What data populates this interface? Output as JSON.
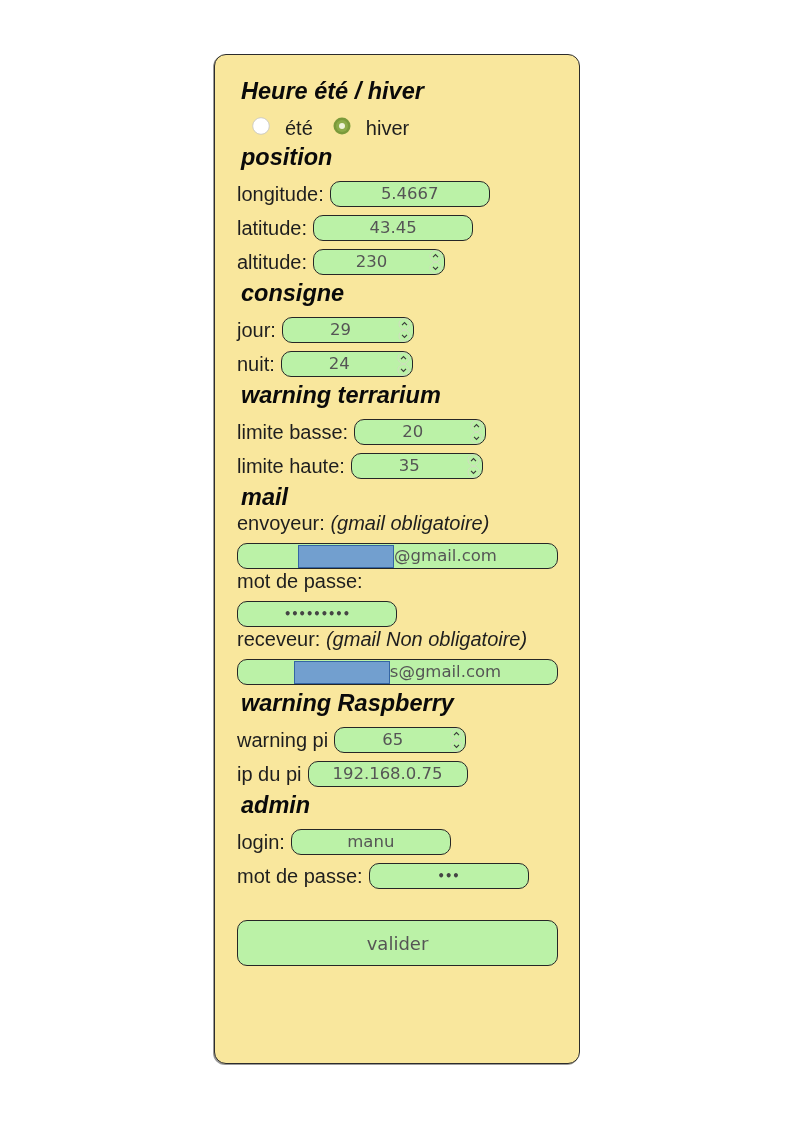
{
  "form": {
    "sections": [
      {
        "title": "Heure été / hiver",
        "items": [
          {
            "kind": "radio_group",
            "options": [
              {
                "label": "été",
                "selected": false
              },
              {
                "label": "hiver",
                "selected": true
              }
            ]
          }
        ]
      },
      {
        "title": "position",
        "items": [
          {
            "kind": "row",
            "label": "longitude:",
            "field": {
              "kind": "text",
              "value": "5.4667"
            }
          },
          {
            "kind": "row",
            "label": "latitude:",
            "field": {
              "kind": "text",
              "value": "43.45"
            }
          },
          {
            "kind": "row",
            "label": "altitude:",
            "field": {
              "kind": "number",
              "value": "230"
            }
          }
        ]
      },
      {
        "title": "consigne",
        "items": [
          {
            "kind": "row",
            "label": "jour:",
            "field": {
              "kind": "number",
              "value": "29"
            }
          },
          {
            "kind": "row",
            "label": "nuit:",
            "field": {
              "kind": "number",
              "value": "24"
            }
          }
        ]
      },
      {
        "title": "warning terrarium",
        "items": [
          {
            "kind": "row",
            "label": "limite basse:",
            "field": {
              "kind": "number",
              "value": "20"
            }
          },
          {
            "kind": "row",
            "label": "limite haute:",
            "field": {
              "kind": "number",
              "value": "35"
            }
          }
        ]
      },
      {
        "title": "mail",
        "items": [
          {
            "kind": "stacked",
            "label": "envoyeur: *(gmail obligatoire)*",
            "field": {
              "kind": "email",
              "value": "@gmail.com",
              "redacted": true
            }
          },
          {
            "kind": "stacked",
            "label": "mot de passe:",
            "field": {
              "kind": "password",
              "value": "•••••••••"
            }
          },
          {
            "kind": "stacked",
            "label": "receveur: *(gmail Non obligatoire)*",
            "field": {
              "kind": "email",
              "value": "s@gmail.com",
              "redacted": true
            }
          }
        ]
      },
      {
        "title": "warning Raspberry",
        "items": [
          {
            "kind": "row",
            "label": "warning pi",
            "field": {
              "kind": "number",
              "value": "65"
            }
          },
          {
            "kind": "row",
            "label": "ip du pi",
            "field": {
              "kind": "text",
              "value": "192.168.0.75"
            }
          }
        ]
      },
      {
        "title": "admin",
        "items": [
          {
            "kind": "row",
            "label": "login:",
            "field": {
              "kind": "text",
              "value": "manu"
            }
          },
          {
            "kind": "row",
            "label": "mot de passe:",
            "field": {
              "kind": "password",
              "value": "•••"
            }
          }
        ]
      }
    ],
    "submit": {
      "label": "valider"
    }
  }
}
